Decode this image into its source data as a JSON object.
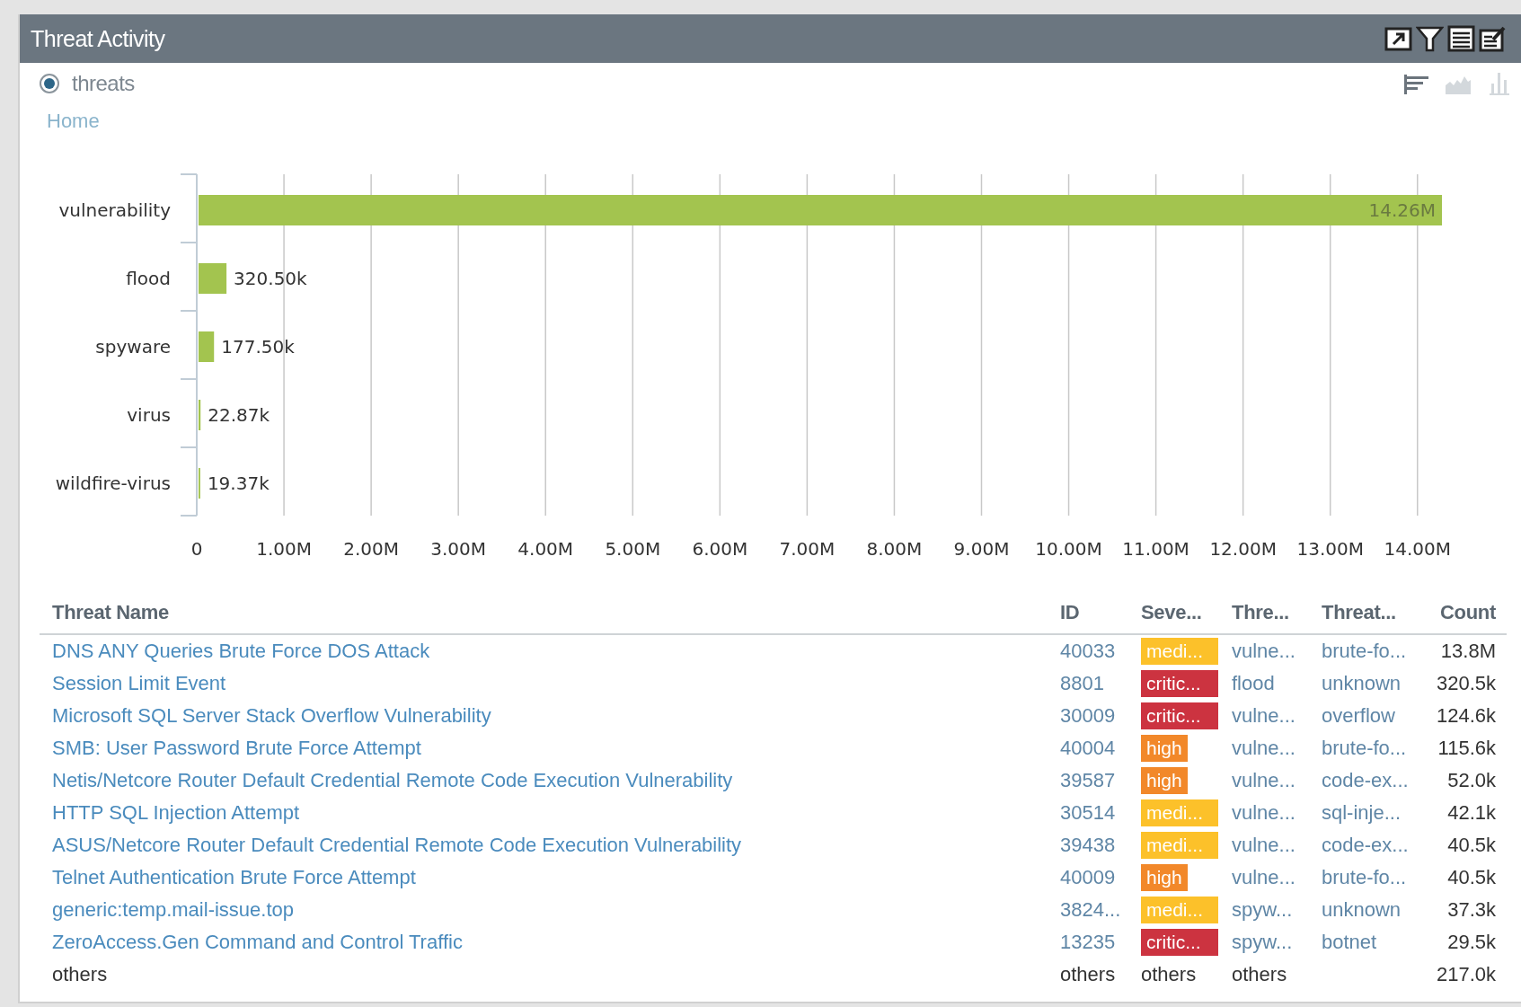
{
  "panel": {
    "title": "Threat Activity"
  },
  "view_option": {
    "label": "threats",
    "selected": true
  },
  "breadcrumb": "Home",
  "chart_types": [
    {
      "kind": "bars-horizontal",
      "selected": true
    },
    {
      "kind": "area",
      "selected": false
    },
    {
      "kind": "bars-vertical",
      "selected": false
    }
  ],
  "chart_data": {
    "type": "bar",
    "orientation": "horizontal",
    "categories": [
      "vulnerability",
      "flood",
      "spyware",
      "virus",
      "wildfire-virus"
    ],
    "values": [
      14260000,
      320500,
      177500,
      22870,
      19370
    ],
    "value_labels": [
      "14.26M",
      "320.50k",
      "177.50k",
      "22.87k",
      "19.37k"
    ],
    "grid": true,
    "xlim": [
      0,
      14260000
    ],
    "xticks": [
      {
        "value": 0,
        "label": "0"
      },
      {
        "value": 1000000,
        "label": "1.00M"
      },
      {
        "value": 2000000,
        "label": "2.00M"
      },
      {
        "value": 3000000,
        "label": "3.00M"
      },
      {
        "value": 4000000,
        "label": "4.00M"
      },
      {
        "value": 5000000,
        "label": "5.00M"
      },
      {
        "value": 6000000,
        "label": "6.00M"
      },
      {
        "value": 7000000,
        "label": "7.00M"
      },
      {
        "value": 8000000,
        "label": "8.00M"
      },
      {
        "value": 9000000,
        "label": "9.00M"
      },
      {
        "value": 10000000,
        "label": "10.00M"
      },
      {
        "value": 11000000,
        "label": "11.00M"
      },
      {
        "value": 12000000,
        "label": "12.00M"
      },
      {
        "value": 13000000,
        "label": "13.00M"
      },
      {
        "value": 14000000,
        "label": "14.00M"
      }
    ]
  },
  "table": {
    "columns": [
      "Threat Name",
      "ID",
      "Seve...",
      "Thre...",
      "Threat...",
      "Count"
    ],
    "rows": [
      {
        "kind": "link",
        "threat_name": "DNS ANY Queries Brute Force DOS Attack",
        "id": "40033",
        "severity": {
          "label": "medi...",
          "kind": "medium"
        },
        "threat_type": "vulne...",
        "subtype": "brute-fo...",
        "count": "13.8M"
      },
      {
        "kind": "link",
        "threat_name": "Session Limit Event",
        "id": "8801",
        "severity": {
          "label": "critic...",
          "kind": "critical"
        },
        "threat_type": "flood",
        "subtype": "unknown",
        "count": "320.5k"
      },
      {
        "kind": "link",
        "threat_name": "Microsoft SQL Server Stack Overflow Vulnerability",
        "id": "30009",
        "severity": {
          "label": "critic...",
          "kind": "critical"
        },
        "threat_type": "vulne...",
        "subtype": "overflow",
        "count": "124.6k"
      },
      {
        "kind": "link",
        "threat_name": "SMB: User Password Brute Force Attempt",
        "id": "40004",
        "severity": {
          "label": "high",
          "kind": "high"
        },
        "threat_type": "vulne...",
        "subtype": "brute-fo...",
        "count": "115.6k"
      },
      {
        "kind": "link",
        "threat_name": "Netis/Netcore Router Default Credential Remote Code Execution Vulnerability",
        "id": "39587",
        "severity": {
          "label": "high",
          "kind": "high"
        },
        "threat_type": "vulne...",
        "subtype": "code-ex...",
        "count": "52.0k"
      },
      {
        "kind": "link",
        "threat_name": "HTTP SQL Injection Attempt",
        "id": "30514",
        "severity": {
          "label": "medi...",
          "kind": "medium"
        },
        "threat_type": "vulne...",
        "subtype": "sql-inje...",
        "count": "42.1k"
      },
      {
        "kind": "link",
        "threat_name": "ASUS/Netcore Router Default Credential Remote Code Execution Vulnerability",
        "id": "39438",
        "severity": {
          "label": "medi...",
          "kind": "medium"
        },
        "threat_type": "vulne...",
        "subtype": "code-ex...",
        "count": "40.5k"
      },
      {
        "kind": "link",
        "threat_name": "Telnet Authentication Brute Force Attempt",
        "id": "40009",
        "severity": {
          "label": "high",
          "kind": "high"
        },
        "threat_type": "vulne...",
        "subtype": "brute-fo...",
        "count": "40.5k"
      },
      {
        "kind": "link",
        "threat_name": "generic:temp.mail-issue.top",
        "id": "3824...",
        "severity": {
          "label": "medi...",
          "kind": "medium"
        },
        "threat_type": "spyw...",
        "subtype": "unknown",
        "count": "37.3k"
      },
      {
        "kind": "link",
        "threat_name": "ZeroAccess.Gen Command and Control Traffic",
        "id": "13235",
        "severity": {
          "label": "critic...",
          "kind": "critical"
        },
        "threat_type": "spyw...",
        "subtype": "botnet",
        "count": "29.5k"
      },
      {
        "kind": "plain",
        "threat_name": "others",
        "id": "others",
        "severity": {
          "label": "others",
          "kind": "plain"
        },
        "threat_type": "others",
        "count": "217.0k"
      }
    ]
  }
}
